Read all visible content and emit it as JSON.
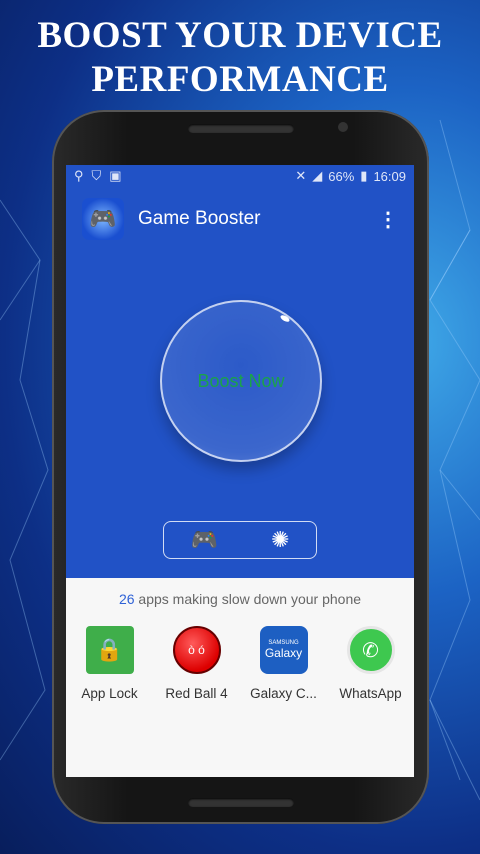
{
  "headline": [
    "BOOST YOUR DEVICE",
    "PERFORMANCE"
  ],
  "status": {
    "battery": "66%",
    "time": "16:09"
  },
  "appbar": {
    "title": "Game Booster"
  },
  "boost": {
    "label": "Boost Now"
  },
  "summary": {
    "count": "26",
    "text": " apps making slow down your phone"
  },
  "apps": [
    {
      "name": "App Lock",
      "icon": "app-lock-icon"
    },
    {
      "name": "Red Ball 4",
      "icon": "red-ball-icon"
    },
    {
      "name": "Galaxy C...",
      "icon": "samsung-galaxy-icon",
      "icon_text": "Galaxy",
      "icon_sub": "SAMSUNG"
    },
    {
      "name": "WhatsApp",
      "icon": "whatsapp-icon"
    }
  ],
  "colors": {
    "primary": "#2152c6",
    "boost_text": "#1aa34a",
    "count": "#2f62d6"
  }
}
